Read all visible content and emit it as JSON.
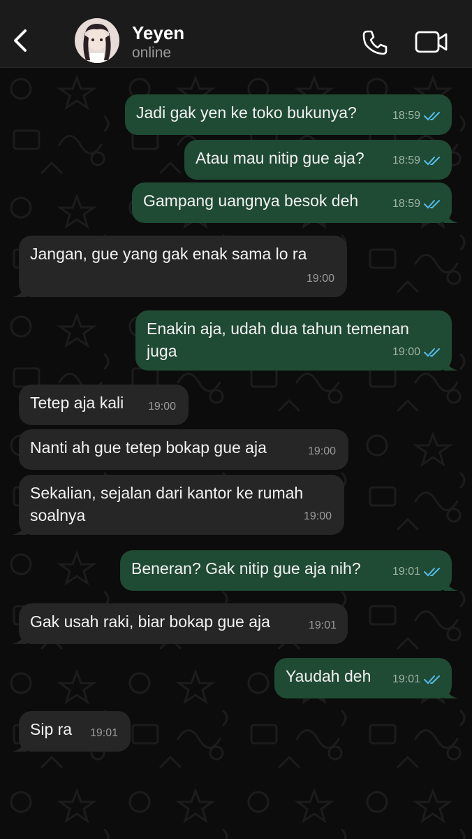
{
  "header": {
    "contact_name": "Yeyen",
    "contact_status": "online"
  },
  "colors": {
    "outgoing_bubble": "#1f4a33",
    "incoming_bubble": "#262626",
    "read_ticks": "#53bdeb",
    "header_bg": "#1b1b1b"
  },
  "icons": {
    "back": "chevron-left-icon",
    "call": "phone-icon",
    "video": "video-camera-icon",
    "read": "double-check-icon"
  },
  "messages": [
    {
      "dir": "out",
      "text": "Jadi gak yen ke toko bukunya?",
      "time": "18:59",
      "read": true
    },
    {
      "dir": "out",
      "text": "Atau mau nitip gue aja?",
      "time": "18:59",
      "read": true
    },
    {
      "dir": "out",
      "text": "Gampang uangnya besok deh",
      "time": "18:59",
      "read": true
    },
    {
      "dir": "in",
      "text": "Jangan, gue yang gak enak sama lo ra",
      "time": "19:00"
    },
    {
      "dir": "out",
      "text": "Enakin aja, udah dua tahun temenan juga",
      "time": "19:00",
      "read": true
    },
    {
      "dir": "in",
      "text": "Tetep aja kali",
      "time": "19:00"
    },
    {
      "dir": "in",
      "text": "Nanti ah gue tetep bokap gue aja",
      "time": "19:00"
    },
    {
      "dir": "in",
      "text": "Sekalian, sejalan dari kantor ke rumah soalnya",
      "time": "19:00"
    },
    {
      "dir": "out",
      "text": "Beneran? Gak nitip gue aja nih?",
      "time": "19:01",
      "read": true
    },
    {
      "dir": "in",
      "text": "Gak usah raki, biar bokap gue aja",
      "time": "19:01"
    },
    {
      "dir": "out",
      "text": "Yaudah deh",
      "time": "19:01",
      "read": true
    },
    {
      "dir": "in",
      "text": "Sip ra",
      "time": "19:01"
    }
  ]
}
